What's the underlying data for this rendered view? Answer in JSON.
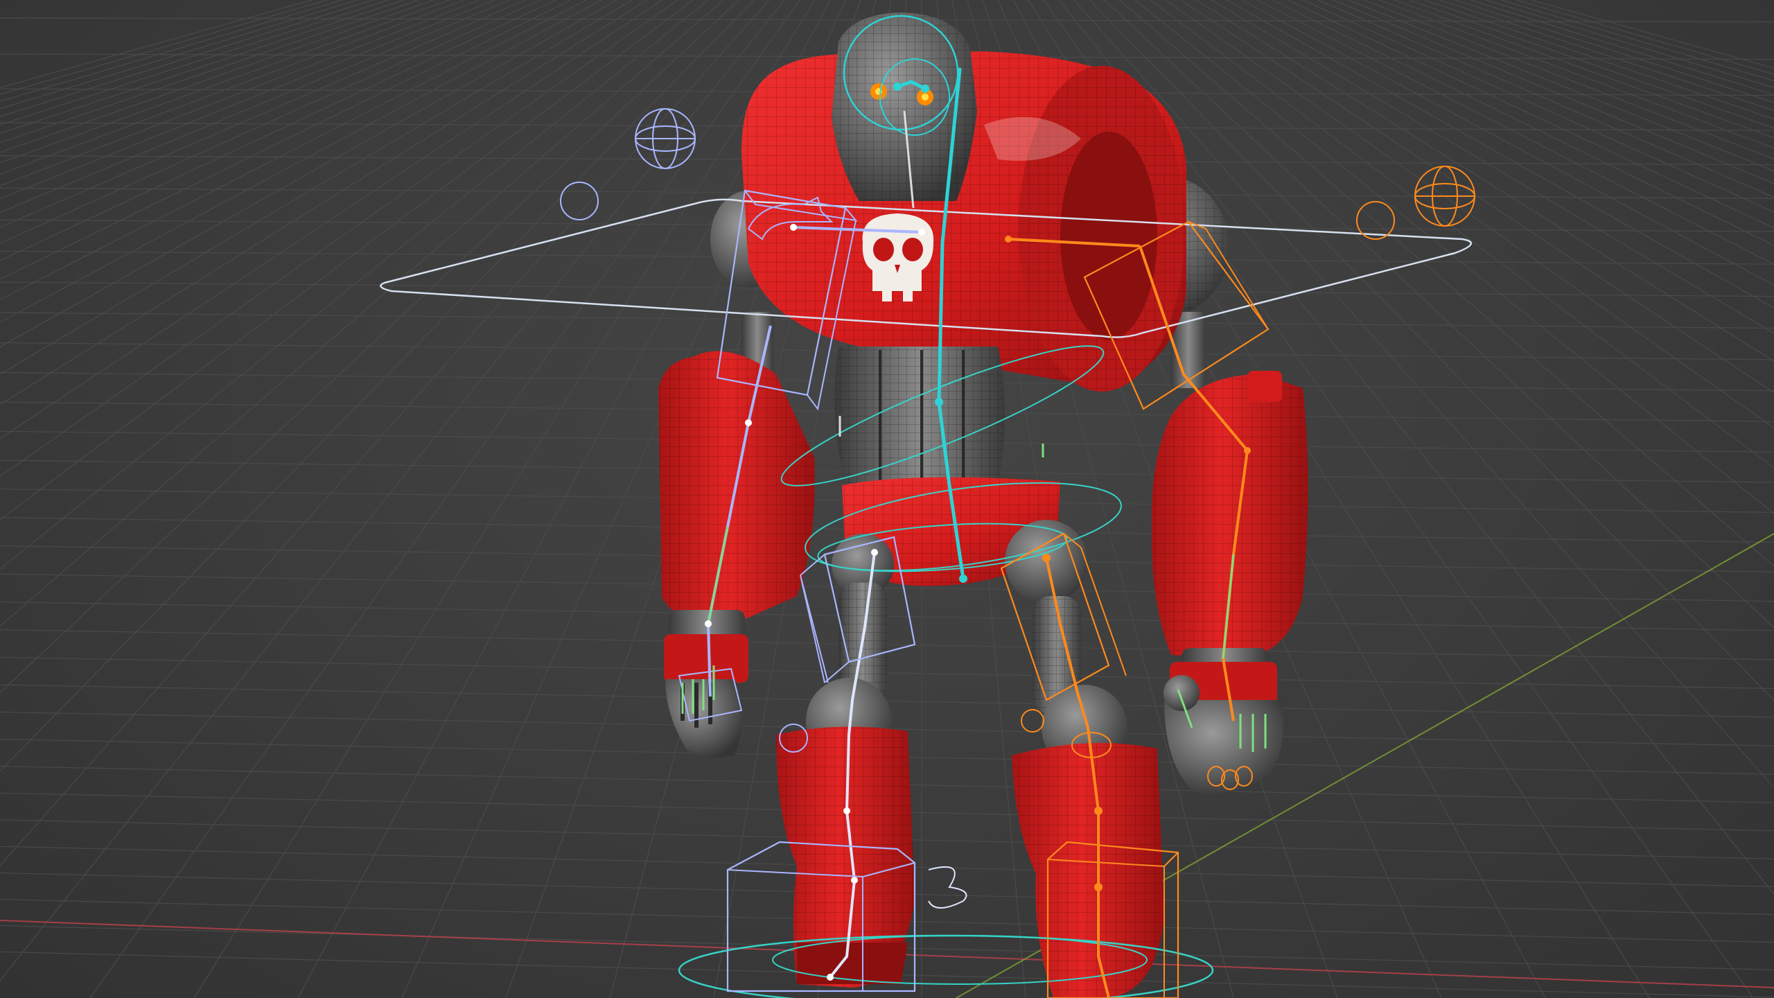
{
  "viewport": {
    "background_color": "#3d3d3d",
    "grid_color": "#4a4a4a",
    "axis_x_color": "#b8414b",
    "axis_y_color": "#7fa334"
  },
  "character": {
    "body_color": "#d81e1e",
    "body_dark_color": "#9e1212",
    "joint_color": "#6a6a6a",
    "emblem": "skull-icon"
  },
  "rig": {
    "spine_color": "#2ed3d6",
    "left_side_color": "#a9b6ff",
    "right_side_color": "#ff8a1c",
    "fk_bone_color": "#7fe07f",
    "root_circle_color": "#37d3c7",
    "control_shape_color": "#c8d4e6"
  }
}
